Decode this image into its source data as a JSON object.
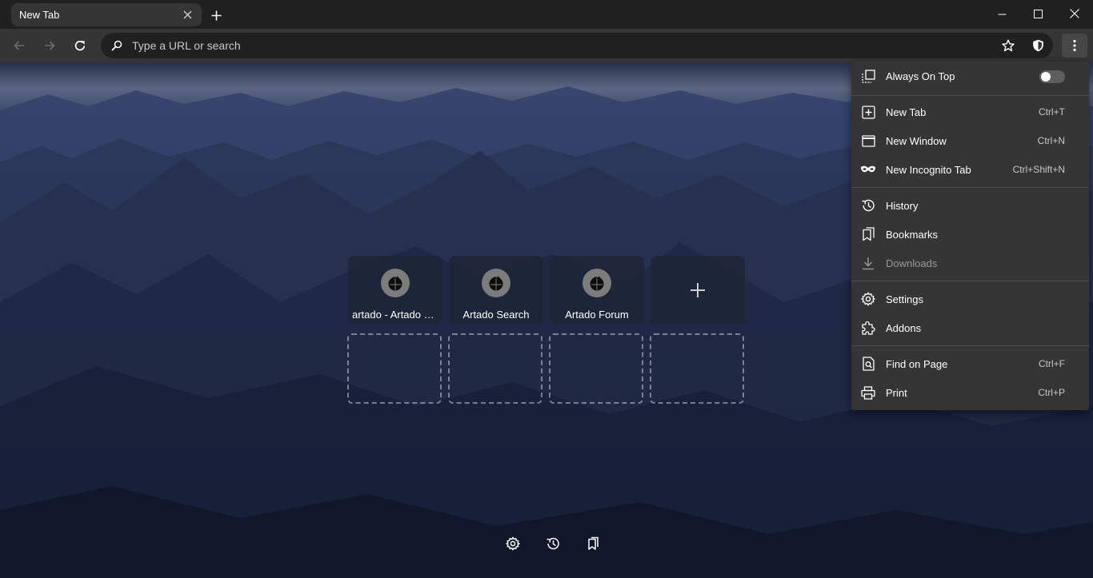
{
  "tab": {
    "title": "New Tab"
  },
  "omnibox": {
    "placeholder": "Type a URL or search"
  },
  "shortcuts": [
    {
      "label": "artado - Artado Search",
      "icon": "artado-logo-icon"
    },
    {
      "label": "Artado Search",
      "icon": "artado-logo-icon"
    },
    {
      "label": "Artado Forum",
      "icon": "artado-logo-icon"
    }
  ],
  "menu": {
    "always_on_top": {
      "label": "Always On Top",
      "enabled": false
    },
    "new_tab": {
      "label": "New Tab",
      "shortcut": "Ctrl+T"
    },
    "new_window": {
      "label": "New Window",
      "shortcut": "Ctrl+N"
    },
    "new_incognito": {
      "label": "New Incognito Tab",
      "shortcut": "Ctrl+Shift+N"
    },
    "history": {
      "label": "History"
    },
    "bookmarks": {
      "label": "Bookmarks"
    },
    "downloads": {
      "label": "Downloads",
      "disabled": true
    },
    "settings": {
      "label": "Settings"
    },
    "addons": {
      "label": "Addons"
    },
    "find_on_page": {
      "label": "Find on Page",
      "shortcut": "Ctrl+F"
    },
    "print": {
      "label": "Print",
      "shortcut": "Ctrl+P"
    }
  },
  "colors": {
    "titlebar": "#202020",
    "toolbar": "#353535",
    "menu": "#353535",
    "accent_text": "#ffffff"
  }
}
